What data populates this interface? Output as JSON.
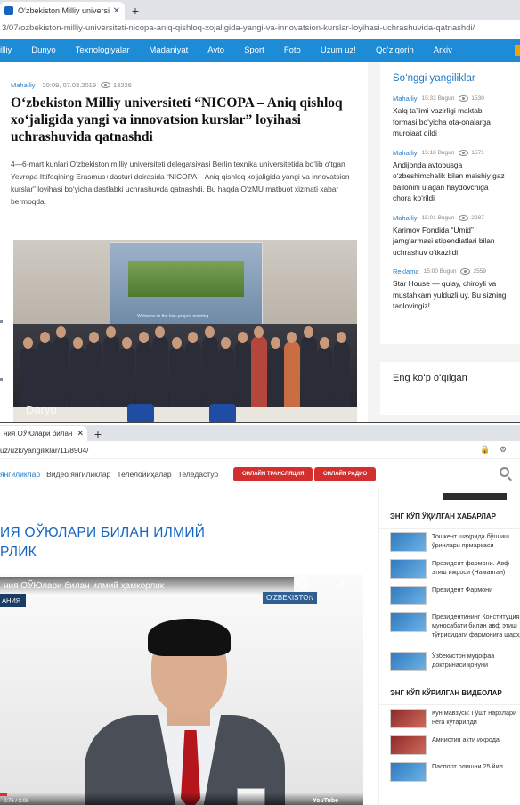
{
  "top": {
    "tab_title": "O‘zbekiston Milliy universiteti “NIC",
    "url": "3/07/ozbekiston-milliy-universiteti-nicopa-aniq-qishloq-xojaligida-yangi-va-innovatsion-kurslar-loyihasi-uchrashuvida-qatnashdi/",
    "nav": [
      "illiy",
      "Dunyo",
      "Texnologiyalar",
      "Madaniyat",
      "Avto",
      "Sport",
      "Foto",
      "Uzum uz!",
      "Qo‘ziqorin",
      "Arxiv"
    ],
    "article": {
      "category": "Mahalliy",
      "date": "20:09, 07.03.2019",
      "views": "13226",
      "headline": "O‘zbekiston Milliy universiteti “NICOPA – Aniq qishloq xo‘jaligida yangi va innovatsion kurslar” loyihasi uchrashuvida qatnashdi",
      "lead": "4—6-mart kunlari O‘zbekiston milliy universiteti delegatsiyasi Berlin texnika universitetida bo‘lib o‘tgan Yevropa Ittifoqining Erasmus+dasturi doirasida “NICOPA – Aniq qishloq xo‘jaligida yangi va innovatsion kurslar” loyihasi bo‘yicha dastlabki uchrashuvda qatnashdi. Bu haqda O‘zMU matbuot xizmati xabar bermoqda.",
      "photo_watermark": "Daryo"
    },
    "sidebar": {
      "title": "So‘nggi yangiliklar",
      "items": [
        {
          "category": "Mahalliy",
          "time": "15:33 Bugun",
          "views": "1530",
          "text": "Xalq ta’limi vazirligi maktab formasi bo‘yicha ota-onalarga murojaat qildi"
        },
        {
          "category": "Mahalliy",
          "time": "15:18 Bugun",
          "views": "1571",
          "text": "Andijonda avtobusga o‘zbeshimchalik bilan maishiy gaz ballonini ulagan haydovchiga chora ko‘rildi"
        },
        {
          "category": "Mahalliy",
          "time": "15:01 Bugun",
          "views": "2287",
          "text": "Karimov Fondida “Umid” jamg‘armasi stipendiatlari bilan uchrashuv o‘tkazildi"
        },
        {
          "category": "Reklama",
          "time": "15:00 Bugun",
          "views": "2559",
          "text": "Star House — qulay, chiroyli va mustahkam yulduzli uy. Bu sizning tanlovingiz!"
        }
      ],
      "most_read_title": "Eng ko‘p o‘qilgan"
    }
  },
  "bottom": {
    "tab_title": "ния ОЎЮлари билан илм",
    "url": "uz/uzk/yangiliklar/11/8904/",
    "nav": [
      "янгиликлар",
      "Видео янгиликлар",
      "Телелойиҳалар",
      "Теледастур"
    ],
    "live_btn": "ОНЛАЙН ТРАНСЛЯЦИЯ",
    "radio_btn": "ОНЛАЙН РАДИО",
    "headline_line1": "ИЯ ОЎЮЛАРИ БИЛАН ИЛМИЙ",
    "headline_line2": "РЛИК",
    "video": {
      "title": "ния ОЎЮлари билан илмий ҳамкорлик",
      "label": "АНИЯ",
      "watch_later": "Watch later",
      "share": "Share",
      "channel": "O‘ZBEKISTON",
      "channel_num": "24",
      "time": "0:76 / 3:08",
      "platform": "YouTube"
    },
    "sidebar": {
      "read_title": "ЭНГ КЎП ЎҚИЛГАН ХАБАРЛАР",
      "read_items": [
        "Тошкент шаҳрида бўш иш ўринлари ярмаркаси",
        "Президент фармони. Авф этиш ижроси (Наманган)",
        "Президент Фармони",
        "Президентининг Конституция муносабати билан авф этиш тўғрисидаги фармонига шарҳ",
        "Ўзбекистон мудофаа доктринаси қонуни"
      ],
      "video_title": "ЭНГ КЎП КЎРИЛГАН ВИДЕОЛАР",
      "video_items": [
        "Кун мавзуси: Гўшт нархлари нега кўтарилди",
        "Амнистия акти ижрода",
        "Паспорт олишни 25 йил"
      ]
    }
  }
}
